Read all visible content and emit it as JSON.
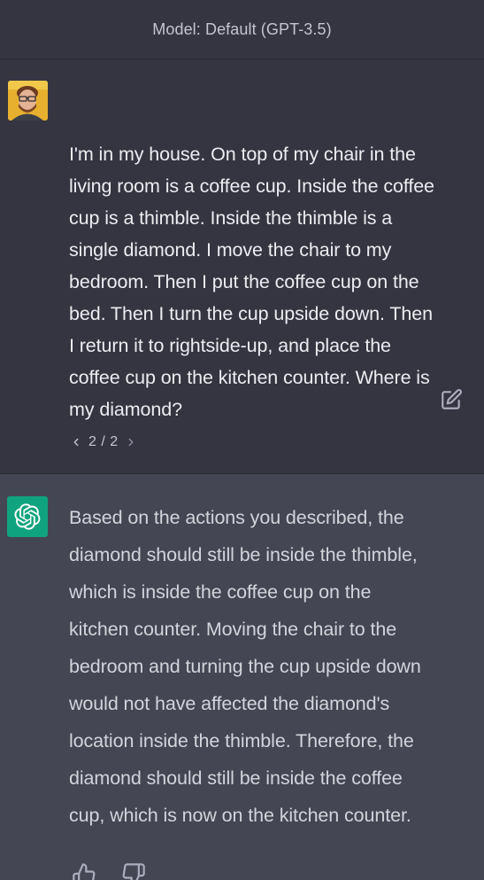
{
  "header": {
    "model_label": "Model: Default (GPT-3.5)"
  },
  "user_message": {
    "lines": [
      "I'm in my house. On top of my chair in the",
      "living room is a coffee cup. Inside the coffee",
      "cup is a thimble. Inside the thimble is a",
      "single diamond. I move the chair to my",
      "bedroom. Then I put the coffee cup on the",
      "bed. Then I turn the cup upside down. Then",
      "I return it to rightside-up, and place the",
      "coffee cup on the kitchen counter. Where is",
      "my diamond?"
    ],
    "pager": {
      "counter": "2 / 2"
    }
  },
  "assistant_message": {
    "lines": [
      "Based on the actions you described, the",
      "diamond should still be inside the thimble,",
      "which is inside the coffee cup on the",
      "kitchen counter. Moving the chair to the",
      "bedroom and turning the cup upside down",
      "would not have affected the diamond's",
      "location inside the thimble. Therefore, the",
      "diamond should still be inside the coffee",
      "cup, which is now on the kitchen counter."
    ]
  },
  "icons": {
    "edit": "edit-icon",
    "prev": "chevron-left-icon",
    "next": "chevron-right-icon",
    "thumbs_up": "thumbs-up-icon",
    "thumbs_down": "thumbs-down-icon",
    "assistant_logo": "openai-logo-icon"
  },
  "colors": {
    "background": "#343541",
    "assistant_background": "#444654",
    "assistant_avatar": "#10a37f"
  }
}
